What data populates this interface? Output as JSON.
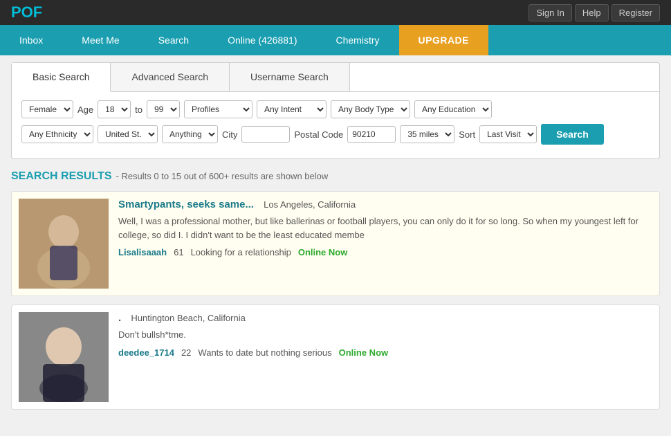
{
  "site": {
    "logo": "POF"
  },
  "topbar": {
    "signin": "Sign In",
    "help": "Help",
    "register": "Register"
  },
  "nav": {
    "items": [
      {
        "label": "Inbox",
        "id": "inbox"
      },
      {
        "label": "Meet Me",
        "id": "meetme"
      },
      {
        "label": "Search",
        "id": "search"
      },
      {
        "label": "Online (426881)",
        "id": "online"
      },
      {
        "label": "Chemistry",
        "id": "chemistry"
      },
      {
        "label": "UPGRADE",
        "id": "upgrade",
        "special": true
      }
    ]
  },
  "search_tabs": [
    {
      "label": "Basic Search",
      "active": true
    },
    {
      "label": "Advanced Search",
      "active": false
    },
    {
      "label": "Username Search",
      "active": false
    }
  ],
  "filters": {
    "gender": "Female",
    "age_label": "Age",
    "age_min": "18",
    "age_to": "to",
    "age_max": "99",
    "profiles": "Profiles",
    "intent": "Any Intent",
    "body_type": "Any Body Type",
    "education": "Any Education",
    "ethnicity": "Any Ethnicity",
    "country": "United St.",
    "looking_for": "Anything",
    "city_label": "City",
    "city_value": "",
    "postal_label": "Postal Code",
    "postal_value": "90210",
    "distance": "35 miles",
    "sort_label": "Sort",
    "sort_value": "Last Visit",
    "search_button": "Search"
  },
  "results": {
    "heading": "SEARCH RESULTS",
    "sub": "- Results 0 to 15 out of 600+ results are shown below",
    "items": [
      {
        "title": "Smartypants, seeks same...",
        "location": "Los Angeles, California",
        "description": "Well, I was a professional mother, but like ballerinas or football players, you can only do it for so long. So when my youngest left for college, so did I. I didn't want to be the least educated membe",
        "username": "Lisalisaaah",
        "age": "61",
        "seeking": "Looking for a relationship",
        "online": "Online Now",
        "highlighted": true,
        "has_photo": true,
        "photo_bg": "#c4a882"
      },
      {
        "title": "",
        "location": "Huntington Beach, California",
        "description": "Don't bullsh*tme.",
        "username": "deedee_1714",
        "age": "22",
        "seeking": "Wants to date but nothing serious",
        "online": "Online Now",
        "highlighted": false,
        "has_photo": true,
        "photo_bg": "#a08060"
      }
    ]
  }
}
